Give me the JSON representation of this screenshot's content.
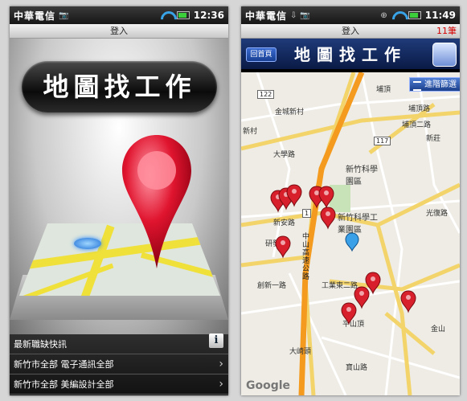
{
  "left_phone": {
    "status": {
      "carrier": "中華電信",
      "time": "12:36"
    },
    "login_label": "登入",
    "splash_title": "地圖找工作",
    "pager": {
      "dots": "●●●●●"
    },
    "news": {
      "header": "最新職缺快訊",
      "info_icon": "i",
      "items": [
        "新竹市全部 電子通訊全部",
        "新竹市全部 美編設計全部"
      ]
    }
  },
  "right_phone": {
    "status": {
      "carrier": "中華電信",
      "time": "11:49"
    },
    "login_label": "登入",
    "result_count": "11筆",
    "home_button": "回首頁",
    "map_title": "地圖找工作",
    "advanced_filter": "進階篩選",
    "map_labels": {
      "jinshan_village": "金城新村",
      "xinzhuang": "新村",
      "daxue_rd": "大學路",
      "puding": "埔頂",
      "puding_rd": "埔頂路",
      "puding_2rd": "埔頂二路",
      "route_122": "122",
      "route_117": "117",
      "route_1": "1",
      "xinzhu_science_park": "新竹科學園區",
      "science_park_2": "新竹科學工業園區",
      "hsinan_rd": "新安路",
      "yanfa_rd": "研發路",
      "chuangxin_rd": "創新一路",
      "gongye_rd": "工業東二路",
      "zhongshan_hwy": "中山高速公路",
      "xinguang_rd": "光復路",
      "guangfu_rd": "光復路",
      "jinshan": "金山",
      "xinzhuang_rd": "新莊",
      "pingshan": "平山頂",
      "daqi": "大崎頭",
      "baoshan_rd": "寶山路",
      "google": "Google"
    }
  }
}
